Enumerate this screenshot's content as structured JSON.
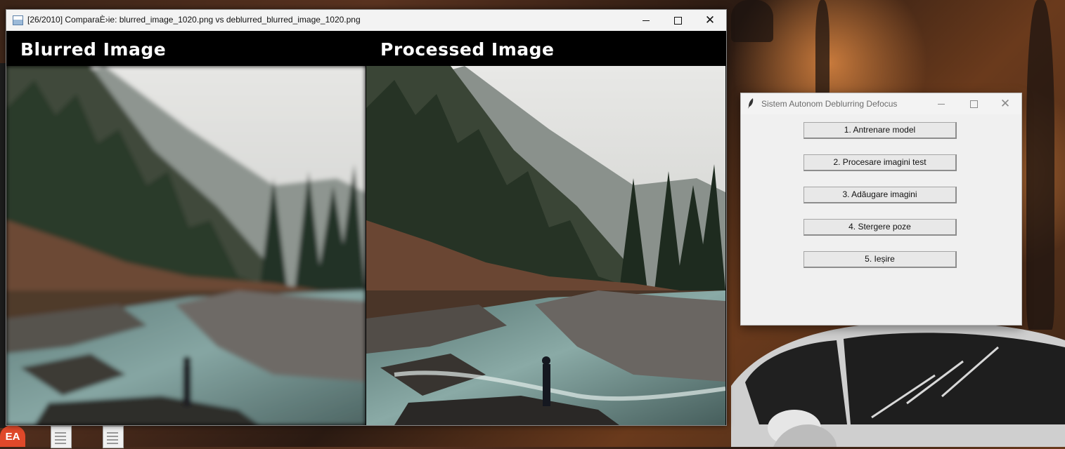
{
  "desktop": {
    "icons": [
      "ea-app-icon",
      "document-icon",
      "document-icon"
    ]
  },
  "image_window": {
    "title": "[26/2010] ComparaÈ›ie: blurred_image_1020.png vs deblurred_blurred_image_1020.png",
    "minimize": "–",
    "maximize": "☐",
    "close": "✕",
    "left_label": "Blurred Image",
    "right_label": "Processed Image"
  },
  "dialog": {
    "title": "Sistem Autonom Deblurring Defocus",
    "buttons": [
      {
        "label": "1. Antrenare model"
      },
      {
        "label": "2. Procesare imagini test"
      },
      {
        "label": "3. Adăugare imagini"
      },
      {
        "label": "4. Stergere poze"
      },
      {
        "label": "5. Ieșire"
      }
    ]
  },
  "colors": {
    "header_band": "#000000",
    "label_text": "#ffffff",
    "dialog_bg": "#f0f0f0",
    "button_bg": "#e8e8e8"
  }
}
